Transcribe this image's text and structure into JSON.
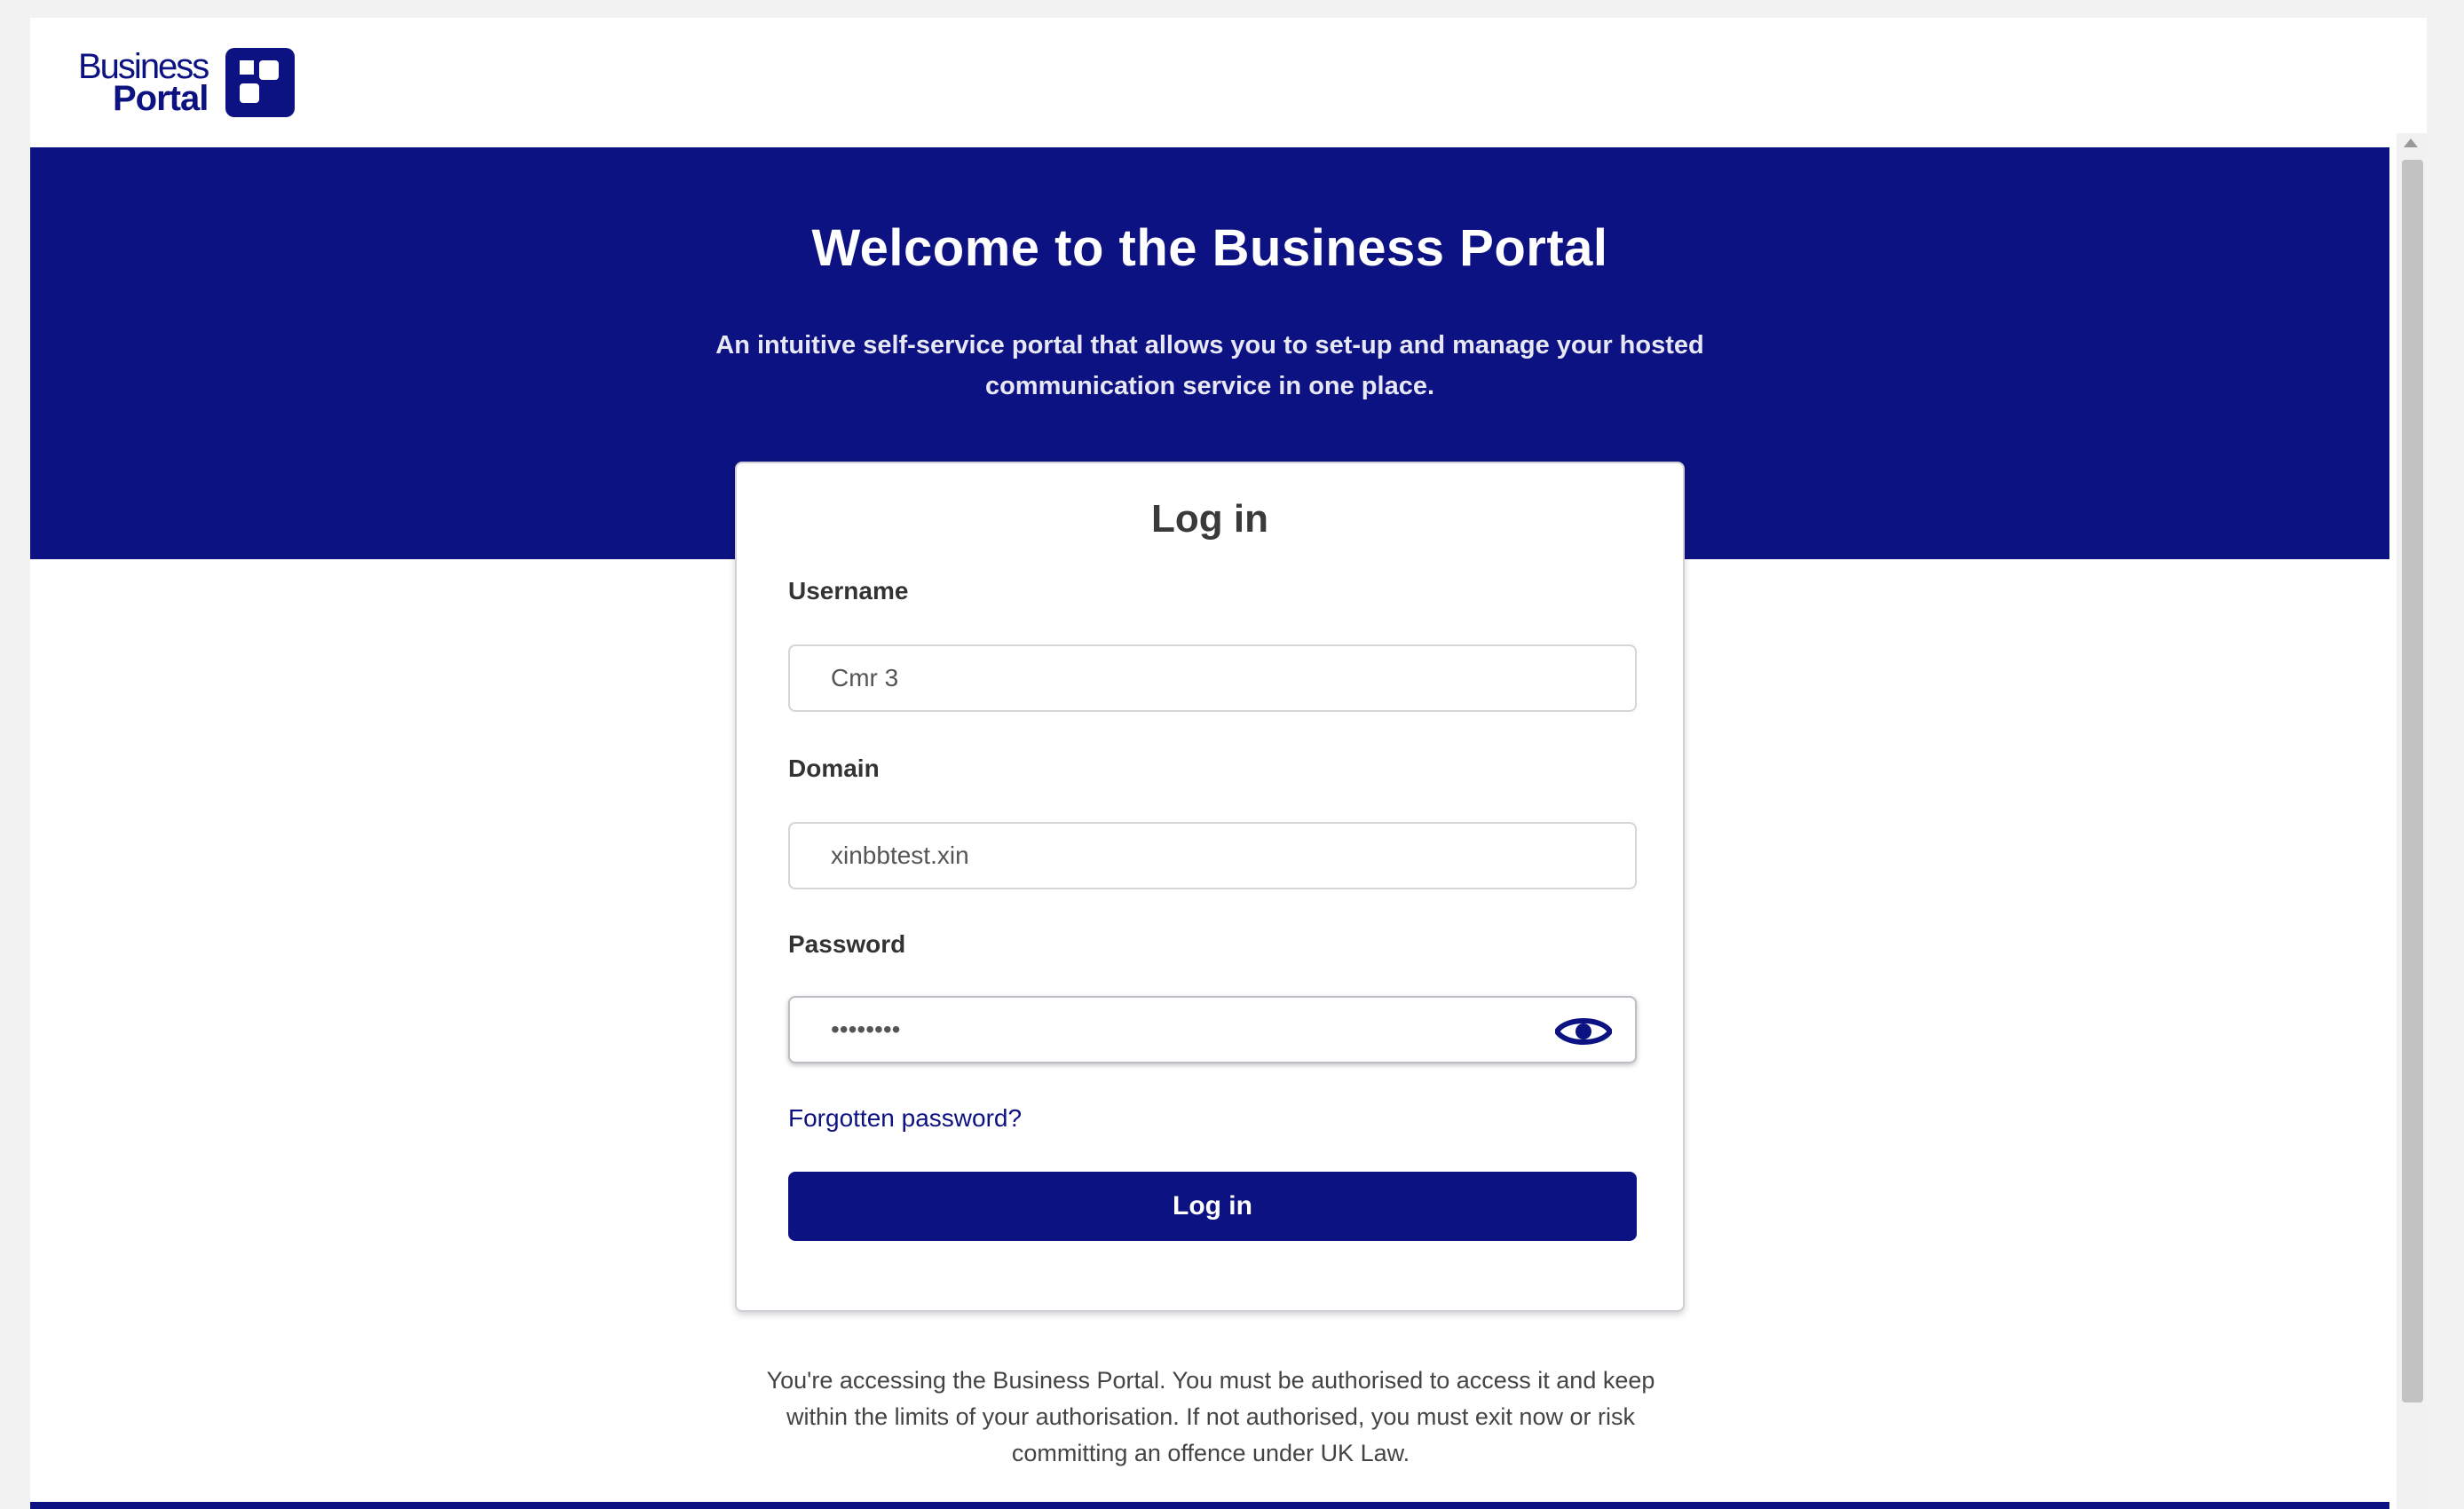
{
  "brand": {
    "logo_line1": "Business",
    "logo_line2": "Portal",
    "color_primary": "#0d1282"
  },
  "hero": {
    "title": "Welcome to the Business Portal",
    "subtitle": "An intuitive self-service portal that allows you to set-up and manage your hosted communication service in one place."
  },
  "login": {
    "title": "Log in",
    "username_label": "Username",
    "username_value": "Cmr 3",
    "domain_label": "Domain",
    "domain_value": "xinbbtest.xin",
    "password_label": "Password",
    "password_value": "••••••••",
    "show_password_icon": "eye-icon",
    "forgot_label": "Forgotten password?",
    "submit_label": "Log in"
  },
  "disclaimer": "You're accessing the Business Portal. You must be authorised to access it and keep within the limits of your authorisation. If not authorised, you must exit now or risk committing an offence under UK Law."
}
